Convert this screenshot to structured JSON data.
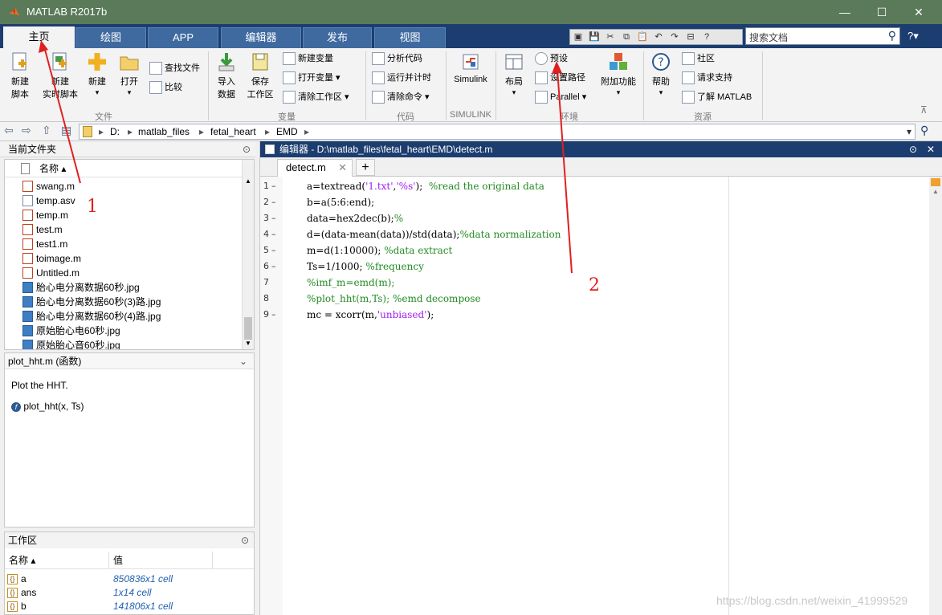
{
  "window": {
    "title": "MATLAB R2017b",
    "minimize": "—",
    "maximize": "☐",
    "close": "✕"
  },
  "ribbon_tabs": [
    "主页",
    "绘图",
    "APP",
    "编辑器",
    "发布",
    "视图"
  ],
  "search_placeholder": "搜索文档",
  "help_menu": "?▾",
  "ribbon": {
    "file": {
      "new_script": "新建\n脚本",
      "new_live_script": "新建\n实时脚本",
      "new": "新建",
      "open": "打开",
      "find_files": "查找文件",
      "compare": "比较",
      "group": "文件"
    },
    "variable": {
      "import": "导入\n数据",
      "save": "保存\n工作区",
      "new_variable": "新建变量",
      "open_variable": "打开变量",
      "clear_workspace": "清除工作区",
      "group": "变量"
    },
    "code": {
      "analyze": "分析代码",
      "run_time": "运行并计时",
      "clear_commands": "清除命令",
      "group": "代码"
    },
    "simulink": {
      "simulink": "Simulink",
      "group": "SIMULINK"
    },
    "env": {
      "layout": "布局",
      "preferences": "预设",
      "set_path": "设置路径",
      "parallel": "Parallel",
      "addons": "附加功能",
      "group": "环境"
    },
    "resources": {
      "help": "帮助",
      "community": "社区",
      "request_support": "请求支持",
      "learn_matlab": "了解 MATLAB",
      "group": "资源"
    }
  },
  "address": {
    "segments": [
      "D:",
      "matlab_files",
      "fetal_heart",
      "EMD"
    ]
  },
  "current_folder": {
    "title": "当前文件夹",
    "column": "名称 ▴",
    "files": [
      {
        "name": "swang.m",
        "type": "m"
      },
      {
        "name": "temp.asv",
        "type": "doc"
      },
      {
        "name": "temp.m",
        "type": "m"
      },
      {
        "name": "test.m",
        "type": "m"
      },
      {
        "name": "test1.m",
        "type": "m"
      },
      {
        "name": "toimage.m",
        "type": "m"
      },
      {
        "name": "Untitled.m",
        "type": "m"
      },
      {
        "name": "胎心电分离数据60秒.jpg",
        "type": "img"
      },
      {
        "name": "胎心电分离数据60秒(3)路.jpg",
        "type": "img"
      },
      {
        "name": "胎心电分离数据60秒(4)路.jpg",
        "type": "img"
      },
      {
        "name": "原始胎心电60秒.jpg",
        "type": "img"
      },
      {
        "name": "原始胎心音60秒.jpg",
        "type": "img"
      }
    ]
  },
  "details": {
    "header": "plot_hht.m  (函数)",
    "description": "Plot the HHT.",
    "signature": "plot_hht(x, Ts)"
  },
  "workspace": {
    "title": "工作区",
    "col_name": "名称 ▴",
    "col_value": "值",
    "vars": [
      {
        "name": "a",
        "value": "850836x1 cell"
      },
      {
        "name": "ans",
        "value": "1x14 cell"
      },
      {
        "name": "b",
        "value": "141806x1 cell"
      }
    ]
  },
  "editor": {
    "title": "编辑器 - D:\\matlab_files\\fetal_heart\\EMD\\detect.m",
    "tab": "detect.m",
    "add_tab": "+",
    "lines": [
      {
        "n": "1",
        "dash": "–",
        "parts": [
          [
            "a=textread(",
            ""
          ],
          [
            "'1.txt'",
            "str"
          ],
          [
            ",",
            ""
          ],
          [
            "'%s'",
            "str"
          ],
          [
            ");  ",
            ""
          ],
          [
            "%read the original data",
            "cmt"
          ]
        ]
      },
      {
        "n": "2",
        "dash": "–",
        "parts": [
          [
            "b=a(5:6:end);",
            ""
          ]
        ]
      },
      {
        "n": "3",
        "dash": "–",
        "parts": [
          [
            "data=hex2dec(b);",
            ""
          ],
          [
            "%",
            "cmt"
          ]
        ]
      },
      {
        "n": "4",
        "dash": "–",
        "parts": [
          [
            "d=(data-mean(data))/std(data);",
            ""
          ],
          [
            "%data normalization",
            "cmt"
          ]
        ]
      },
      {
        "n": "5",
        "dash": "–",
        "parts": [
          [
            "m=d(1:10000); ",
            ""
          ],
          [
            "%data extract",
            "cmt"
          ]
        ]
      },
      {
        "n": "6",
        "dash": "–",
        "parts": [
          [
            "Ts=1/1000; ",
            ""
          ],
          [
            "%frequency",
            "cmt"
          ]
        ]
      },
      {
        "n": "7",
        "dash": "",
        "parts": [
          [
            "%imf_m=emd(m);",
            "cmt"
          ]
        ]
      },
      {
        "n": "8",
        "dash": "",
        "parts": [
          [
            "%plot_hht(m,Ts); %emd decompose",
            "cmt"
          ]
        ]
      },
      {
        "n": "9",
        "dash": "–",
        "parts": [
          [
            "mc = xcorr(m,",
            ""
          ],
          [
            "'unbiased'",
            "str"
          ],
          [
            ");",
            ""
          ]
        ]
      }
    ]
  },
  "annotations": {
    "one": "1",
    "two": "2"
  },
  "watermark": "https://blog.csdn.net/weixin_41999529"
}
